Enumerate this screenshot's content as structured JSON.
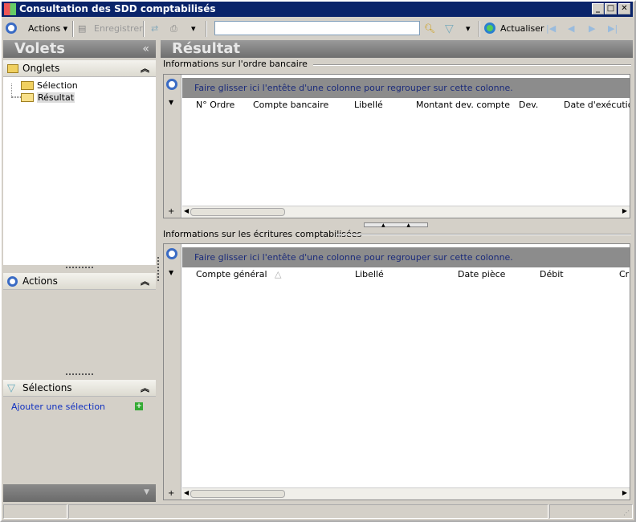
{
  "window": {
    "title": "Consultation des SDD comptabilisés"
  },
  "toolbar": {
    "actions": "Actions",
    "save": "Enregistrer",
    "search_value": "",
    "refresh": "Actualiser"
  },
  "left": {
    "title": "Volets",
    "tabs_header": "Onglets",
    "tree": [
      "Sélection",
      "Résultat"
    ],
    "actions_header": "Actions",
    "selections_header": "Sélections",
    "add_selection": "Ajouter une sélection"
  },
  "main": {
    "title": "Résultat",
    "grid1": {
      "label": "Informations sur l'ordre bancaire",
      "group_hint": "Faire glisser ici l'entête d'une colonne pour regrouper sur cette colonne.",
      "columns": [
        "N° Ordre",
        "Compte bancaire",
        "Libellé",
        "Montant dev. compte",
        "Dev.",
        "Date d'exécution"
      ]
    },
    "grid2": {
      "label": "Informations sur les écritures comptabilisées",
      "group_hint": "Faire glisser ici l'entête d'une colonne pour regrouper sur cette colonne.",
      "columns": [
        "Compte général",
        "Libellé",
        "Date pièce",
        "Débit",
        "Cr"
      ]
    }
  }
}
